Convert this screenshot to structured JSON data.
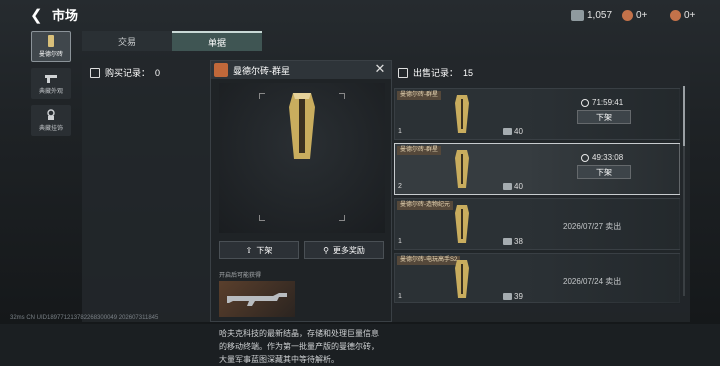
{
  "header": {
    "back_glyph": "❮",
    "title": "市场"
  },
  "currencies": [
    {
      "icon": "banknote-icon",
      "value": "1,057",
      "color": "#8f9a9f"
    },
    {
      "icon": "coin-icon",
      "value": "0+",
      "color": "#c3724a"
    },
    {
      "icon": "token-icon",
      "value": "0+",
      "color": "#c3724a"
    }
  ],
  "nav": [
    {
      "label": "曼德尔砖",
      "active": true
    },
    {
      "label": "典藏外观",
      "active": false
    },
    {
      "label": "典藏挂饰",
      "active": false
    }
  ],
  "tabs": {
    "trade": "交易",
    "orders": "单据"
  },
  "buy": {
    "title": "购买记录：",
    "count": "0"
  },
  "popup": {
    "title": "曼德尔砖-群星",
    "close": "✕",
    "btn_delist": "下架",
    "btn_rewards": "更多奖励",
    "sub": "开启后可能获得",
    "desc": "哈夫克科技的最新结晶，存储和处理巨量信息的移动终端。作为第一批量产版的曼德尔砖，大量军事蓝图深藏其中等待解析。"
  },
  "sell": {
    "title": "出售记录：",
    "count": "15"
  },
  "records": [
    {
      "tag": "曼德尔砖-群星",
      "count": "1",
      "price": "40",
      "timer": "71:59:41",
      "button": "下架",
      "selected": false
    },
    {
      "tag": "曼德尔砖-群星",
      "count": "2",
      "price": "40",
      "timer": "49:33:08",
      "button": "下架",
      "selected": true
    },
    {
      "tag": "曼德尔砖-造物纪元",
      "count": "1",
      "price": "38",
      "sold": "2026/07/27 卖出",
      "selected": false
    },
    {
      "tag": "曼德尔砖-电玩高手S2",
      "count": "1",
      "price": "39",
      "sold": "2026/07/24 卖出",
      "selected": false
    }
  ],
  "status": "32ms    CN UID189771213782268300049 202607311845"
}
